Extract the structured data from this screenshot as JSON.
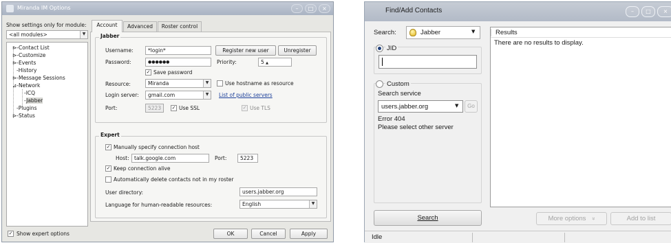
{
  "options_window": {
    "title": "Miranda IM Options",
    "window_buttons": [
      "–",
      "□",
      "×"
    ],
    "module_label": "Show settings only for module:",
    "module_select": "<all modules>",
    "tree": [
      {
        "label": "Contact List",
        "prefix": "⊳"
      },
      {
        "label": "Customize",
        "prefix": "⊳"
      },
      {
        "label": "Events",
        "prefix": "⊳"
      },
      {
        "label": "History",
        "prefix": ""
      },
      {
        "label": "Message Sessions",
        "prefix": "⊳"
      },
      {
        "label": "Network",
        "prefix": "⊿"
      },
      {
        "label": "ICQ",
        "prefix": ""
      },
      {
        "label": "Jabber",
        "prefix": ""
      },
      {
        "label": "Plugins",
        "prefix": ""
      },
      {
        "label": "Status",
        "prefix": "⊳"
      }
    ],
    "show_expert_label": "Show expert options",
    "tabs": [
      "Account",
      "Advanced",
      "Roster control"
    ],
    "jabber_group": "Jabber",
    "username_label": "Username:",
    "username_value": "*login*",
    "register_btn": "Register new user",
    "unregister_btn": "Unregister",
    "password_label": "Password:",
    "password_value": "●●●●●●",
    "priority_label": "Priority:",
    "priority_value": "5",
    "save_password_label": "Save password",
    "resource_label": "Resource:",
    "resource_value": "Miranda",
    "use_hostname_label": "Use hostname as resource",
    "login_server_label": "Login server:",
    "login_server_value": "gmail.com",
    "public_servers_link": "List of public servers",
    "port_label": "Port:",
    "port_value": "5223",
    "use_ssl_label": "Use SSL",
    "use_tls_label": "Use TLS",
    "expert_group": "Expert",
    "manual_host_label": "Manually specify connection host",
    "host_label": "Host:",
    "host_value": "talk.google.com",
    "expert_port_label": "Port:",
    "expert_port_value": "5223",
    "keep_alive_label": "Keep connection alive",
    "auto_delete_label": "Automatically delete contacts not in my roster",
    "user_dir_label": "User directory:",
    "user_dir_value": "users.jabber.org",
    "language_label": "Language for human-readable resources:",
    "language_value": "English",
    "ok_btn": "OK",
    "cancel_btn": "Cancel",
    "apply_btn": "Apply"
  },
  "find_window": {
    "title": "Find/Add Contacts",
    "window_buttons": [
      "–",
      "□",
      "×"
    ],
    "search_label": "Search:",
    "search_protocol": "Jabber",
    "jid_label": "JID",
    "jid_value": "",
    "custom_label": "Custom",
    "search_service_label": "Search service",
    "search_service_value": "users.jabber.org",
    "go_btn": "Go",
    "error_line1": "Error 404",
    "error_line2": "Please select other server",
    "results_header": "Results",
    "results_empty": "There are no results to display.",
    "search_btn": "Search",
    "more_options_btn": "More options",
    "more_options_icon": "«",
    "add_to_list_btn": "Add to list",
    "status_text": "Idle"
  },
  "colors": {
    "options_bg": "#e7e7e3",
    "find_bg": "#f0f0f0",
    "link": "#1b3f9a"
  }
}
